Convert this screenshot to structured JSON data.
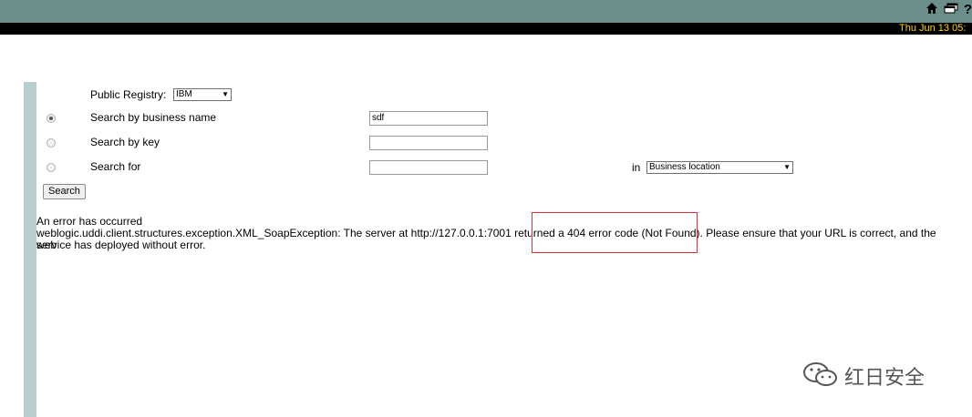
{
  "header": {
    "datetime": "Thu Jun 13 05:",
    "icons": [
      "home-icon",
      "window-icon",
      "help-icon"
    ]
  },
  "form": {
    "registry_label": "Public Registry:",
    "registry_value": "IBM",
    "options": [
      {
        "label": "Search by business name",
        "value": "sdf",
        "checked": true
      },
      {
        "label": "Search by key",
        "value": "",
        "checked": false
      },
      {
        "label": "Search for",
        "value": "",
        "checked": false
      }
    ],
    "in_label": "in",
    "location_value": "Business location",
    "search_button": "Search"
  },
  "error": {
    "title": "An error has occurred",
    "line1": "weblogic.uddi.client.structures.exception.XML_SoapException: The server at http://127.0.0.1:7001 returned a 404 error code (Not Found). Please ensure that your URL is correct, and the web",
    "line2": "service has deployed without error."
  },
  "watermark": {
    "text": "红日安全"
  }
}
